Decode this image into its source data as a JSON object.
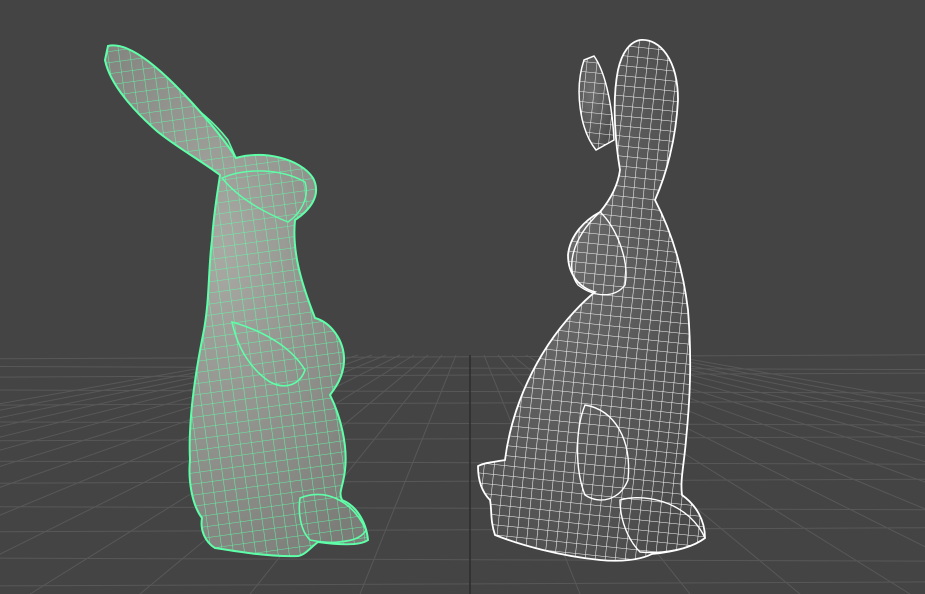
{
  "viewport": {
    "background": "#444444",
    "grid_color": "#585858",
    "grid_center_line_color": "#2e2e2e"
  },
  "objects": [
    {
      "name": "bunny-left",
      "state": "selected",
      "body_color": "#9a9a96",
      "wire_color": "#5effa8"
    },
    {
      "name": "bunny-right",
      "state": "unselected",
      "body_color": "#5a5a5a",
      "wire_color": "#ffffff"
    }
  ]
}
